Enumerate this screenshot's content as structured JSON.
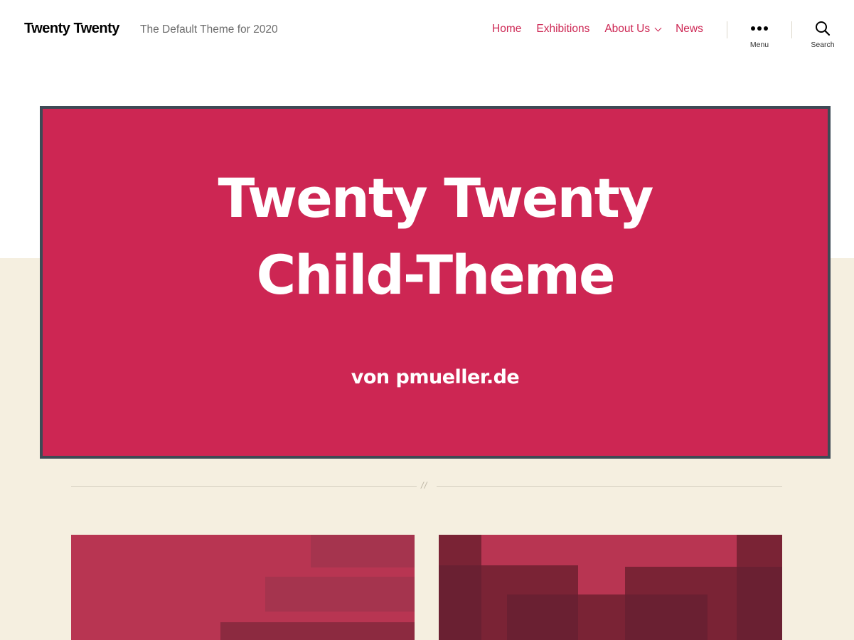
{
  "site": {
    "title": "Twenty Twenty",
    "description": "The Default Theme for 2020"
  },
  "nav": {
    "items": [
      {
        "label": "Home"
      },
      {
        "label": "Exhibitions"
      },
      {
        "label": "About Us",
        "has_submenu": true
      },
      {
        "label": "News"
      }
    ],
    "menu_toggle_label": "Menu",
    "search_toggle_label": "Search"
  },
  "hero": {
    "title_line1": "Twenty Twenty",
    "title_line2": "Child-Theme",
    "subtitle": "von pmueller.de"
  },
  "separator_mark": "//",
  "colors": {
    "accent": "#cd2653",
    "hero_border": "#3e4a55",
    "beige": "#f5efe0",
    "text_muted": "#6d6d6d"
  },
  "icons": {
    "menu": "ellipsis-icon",
    "search": "search-icon",
    "submenu": "chevron-down-icon"
  }
}
